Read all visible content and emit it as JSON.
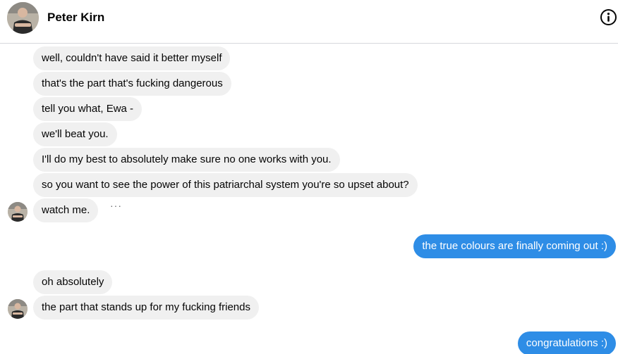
{
  "header": {
    "contact_name": "Peter Kirn",
    "avatar_icon": "avatar-icon",
    "info_icon": "info-icon"
  },
  "messages": [
    {
      "direction": "in",
      "text": "well, couldn't have said it better myself"
    },
    {
      "direction": "in",
      "text": "that's the part that's fucking dangerous"
    },
    {
      "direction": "in",
      "text": "tell you what, Ewa -"
    },
    {
      "direction": "in",
      "text": "we'll beat you."
    },
    {
      "direction": "in",
      "text": "I'll do my best to absolutely make sure no one works with you."
    },
    {
      "direction": "in",
      "text": "so you want to see the power of this patriarchal system you're so upset about?"
    },
    {
      "direction": "in",
      "text": "watch me."
    },
    {
      "direction": "out",
      "text": "the true colours are finally coming out :)"
    },
    {
      "direction": "in",
      "text": "oh absolutely"
    },
    {
      "direction": "in",
      "text": "the part that stands up for my fucking friends"
    },
    {
      "direction": "out",
      "text": "congratulations :)"
    }
  ],
  "more_options": "···",
  "colors": {
    "incoming_bubble": "#f0f0f0",
    "outgoing_bubble": "#2e8de6",
    "divider": "#d6d8dc"
  }
}
